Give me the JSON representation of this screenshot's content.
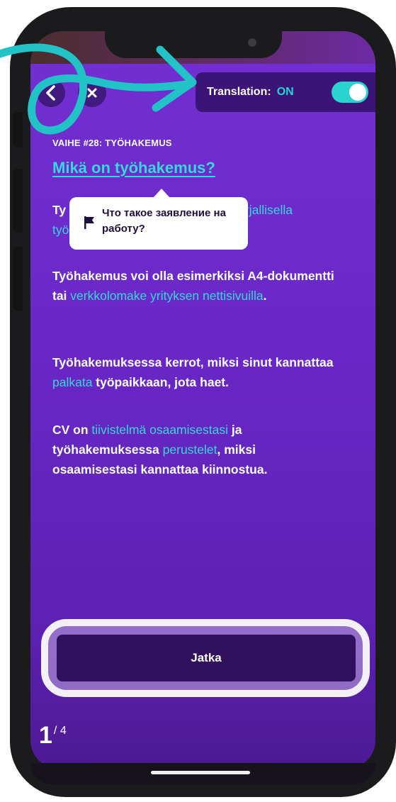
{
  "header": {
    "translation_label": "Translation:",
    "translation_state": "ON"
  },
  "lesson": {
    "label": "VAIHE #28: TYÖHAKEMUS",
    "title": "Mikä on työhakemus?"
  },
  "tooltip": {
    "text": "Что такое заявление на работу?",
    "icon": "flag-icon"
  },
  "paragraphs": {
    "p1": {
      "start": "Ty",
      "highlight_end": "irjallisella",
      "line2_start": "työ"
    },
    "p2": {
      "t1": "Työhakemus voi olla esimerkiksi A4-dokumentti tai ",
      "h1": "verkkolomake yrityksen nettisivuilla",
      "t2": "."
    },
    "p3": {
      "t1": "Työhakemuksessa kerrot, miksi sinut kannattaa ",
      "h1": "palkata",
      "t2": " työpaikkaan, jota haet."
    },
    "p4": {
      "t1": "CV on ",
      "h1": "tiivistelmä osaamisestasi",
      "t2": " ja työhakemuksessa ",
      "h2": "perustelet",
      "t3": ", miksi osaamisestasi kannattaa kiinnostua."
    }
  },
  "footer": {
    "continue_label": "Jatka",
    "page_current": "1",
    "page_total": "/ 4"
  },
  "colors": {
    "accent_teal": "#35d8db",
    "background_purple": "#6a28c8",
    "button_dark": "#31105e"
  }
}
